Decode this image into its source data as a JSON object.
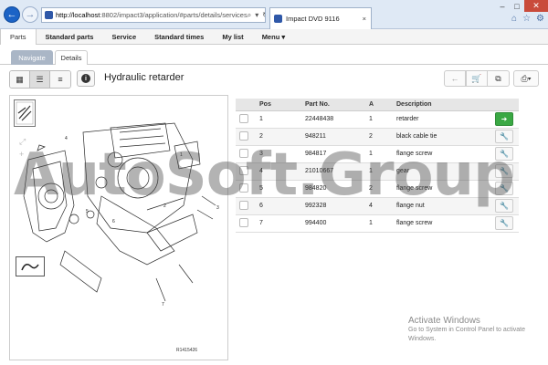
{
  "browser": {
    "url_host": "http://localhost",
    "url_rest": ":8802/impact3/application/#parts/details/services",
    "tab_title": "Impact DVD 9116"
  },
  "menu": {
    "items": [
      "Parts",
      "Standard parts",
      "Service",
      "Standard times",
      "My list",
      "Menu ▾"
    ]
  },
  "subtabs": {
    "navigate": "Navigate",
    "details": "Details"
  },
  "toolbar": {
    "title": "Hydraulic retarder"
  },
  "table": {
    "headers": [
      "",
      "Pos",
      "Part No.",
      "A",
      "Description",
      ""
    ],
    "rows": [
      {
        "pos": "1",
        "part": "22448438",
        "a": "1",
        "desc": "retarder",
        "action": "arrow"
      },
      {
        "pos": "2",
        "part": "948211",
        "a": "2",
        "desc": "black cable tie",
        "action": "wrench"
      },
      {
        "pos": "3",
        "part": "984817",
        "a": "1",
        "desc": "flange screw",
        "action": "wrench"
      },
      {
        "pos": "4",
        "part": "21010667",
        "a": "1",
        "desc": "gear",
        "action": "wrench"
      },
      {
        "pos": "5",
        "part": "984820",
        "a": "2",
        "desc": "flange screw",
        "action": "wrench"
      },
      {
        "pos": "6",
        "part": "992328",
        "a": "4",
        "desc": "flange nut",
        "action": "wrench"
      },
      {
        "pos": "7",
        "part": "994400",
        "a": "1",
        "desc": "flange screw",
        "action": "wrench"
      }
    ]
  },
  "figure": {
    "id": "R1415426",
    "callouts": [
      "1",
      "2",
      "3",
      "4",
      "5",
      "6",
      "7"
    ]
  },
  "watermark": "AutoSoft.Group",
  "activation": {
    "title": "Activate Windows",
    "line": "Go to System in Control Panel to activate Windows."
  }
}
